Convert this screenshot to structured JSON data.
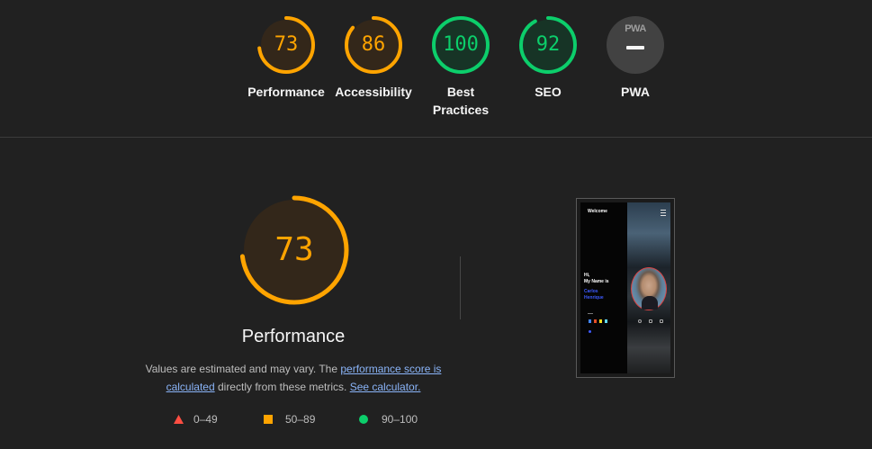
{
  "gauges": [
    {
      "label": "Performance",
      "score": "73",
      "value": 73,
      "color": "#ffa400",
      "bg": "#33271a"
    },
    {
      "label": "Accessibility",
      "score": "86",
      "value": 86,
      "color": "#ffa400",
      "bg": "#33271a"
    },
    {
      "label": "Best Practices",
      "score": "100",
      "value": 100,
      "color": "#0cce6b",
      "bg": "#173426"
    },
    {
      "label": "SEO",
      "score": "92",
      "value": 92,
      "color": "#0cce6b",
      "bg": "#173426"
    },
    {
      "label": "PWA",
      "badge_text": "PWA",
      "icon": "pwa-dash-icon",
      "bg": "#424242"
    }
  ],
  "performance": {
    "score": "73",
    "value": 73,
    "color": "#ffa400",
    "title": "Performance",
    "description_prefix": "Values are estimated and may vary. The ",
    "link_score": "performance score is calculated",
    "description_middle": " directly from these metrics. ",
    "link_calculator": "See calculator."
  },
  "legend": [
    {
      "range": "0–49",
      "shape": "triangle",
      "color": "#ff4e42"
    },
    {
      "range": "50–89",
      "shape": "square",
      "color": "#ffa400"
    },
    {
      "range": "90–100",
      "shape": "circle",
      "color": "#0cce6b"
    }
  ],
  "screenshot": {
    "welcome": "Welcome",
    "greeting_line1": "Hi,",
    "greeting_line2": "My Name is",
    "name_line1": "Carlos",
    "name_line2": "Henrique"
  }
}
